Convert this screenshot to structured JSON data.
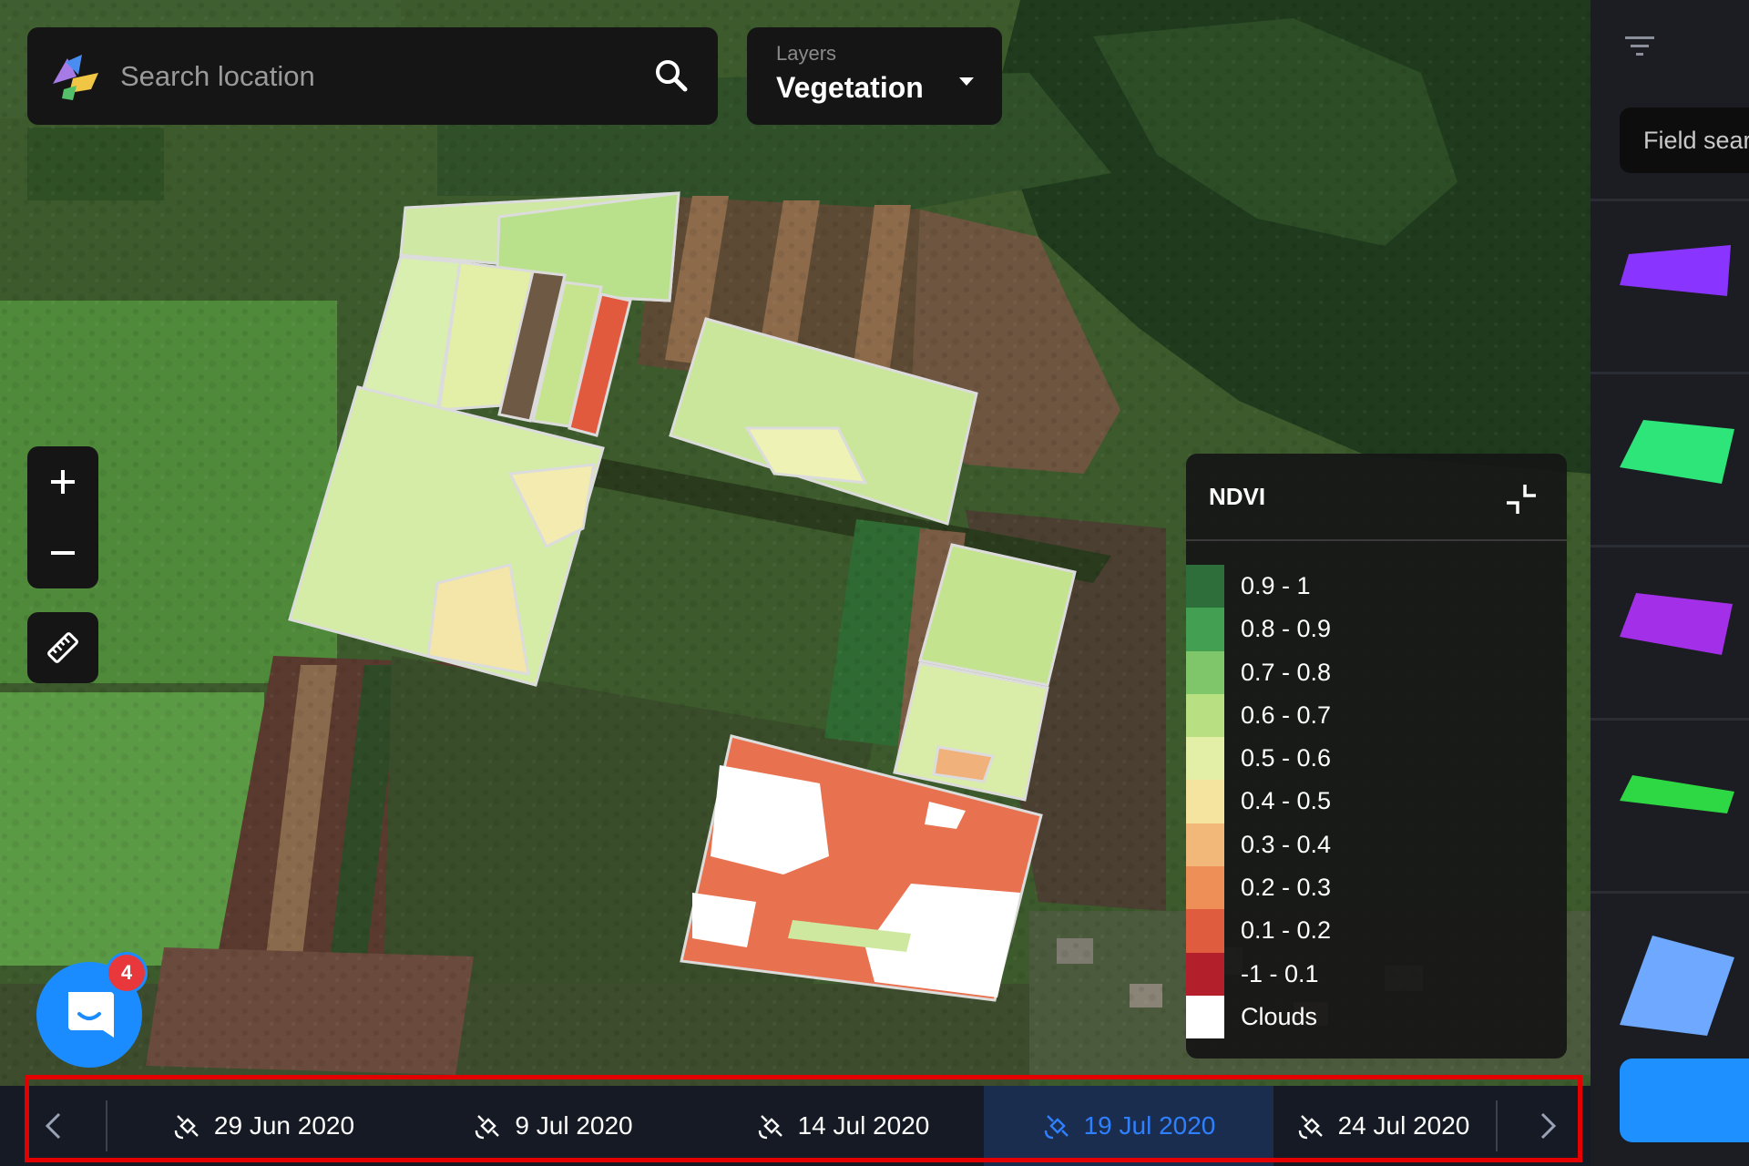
{
  "search": {
    "placeholder": "Search location"
  },
  "layers": {
    "caption": "Layers",
    "value": "Vegetation"
  },
  "legend": {
    "title": "NDVI",
    "items": [
      {
        "label": "0.9 - 1",
        "color": "#2e6e3a"
      },
      {
        "label": "0.8 - 0.9",
        "color": "#43a052"
      },
      {
        "label": "0.7 - 0.8",
        "color": "#7fc66a"
      },
      {
        "label": "0.6 - 0.7",
        "color": "#b8df82"
      },
      {
        "label": "0.5 - 0.6",
        "color": "#e3efa6"
      },
      {
        "label": "0.4 - 0.5",
        "color": "#f5e3a0"
      },
      {
        "label": "0.3 - 0.4",
        "color": "#f2b87a"
      },
      {
        "label": "0.2 - 0.3",
        "color": "#ee8f58"
      },
      {
        "label": "0.1 - 0.2",
        "color": "#e05c3e"
      },
      {
        "label": "-1 - 0.1",
        "color": "#b3202b"
      },
      {
        "label": "Clouds",
        "color": "#ffffff"
      }
    ]
  },
  "chat": {
    "badge": "4"
  },
  "timeline": {
    "dates": [
      "29 Jun 2020",
      "9 Jul 2020",
      "14 Jul 2020",
      "19 Jul 2020",
      "24 Jul 2020"
    ],
    "active_date": "19 Jul 2020"
  },
  "sidebar": {
    "search_placeholder": "Field search",
    "fields": [
      {
        "color": "#8a35ff",
        "icon": "field-shape-icon"
      },
      {
        "color": "#2ee57a",
        "icon": "field-shape-icon"
      },
      {
        "color": "#a330e8",
        "icon": "field-shape-icon"
      },
      {
        "color": "#2ed844",
        "icon": "field-shape-icon"
      },
      {
        "color": "#6ea8ff",
        "icon": "field-shape-icon"
      }
    ]
  },
  "colors": {
    "accent": "#1e90ff",
    "highlight": "#e30000"
  }
}
